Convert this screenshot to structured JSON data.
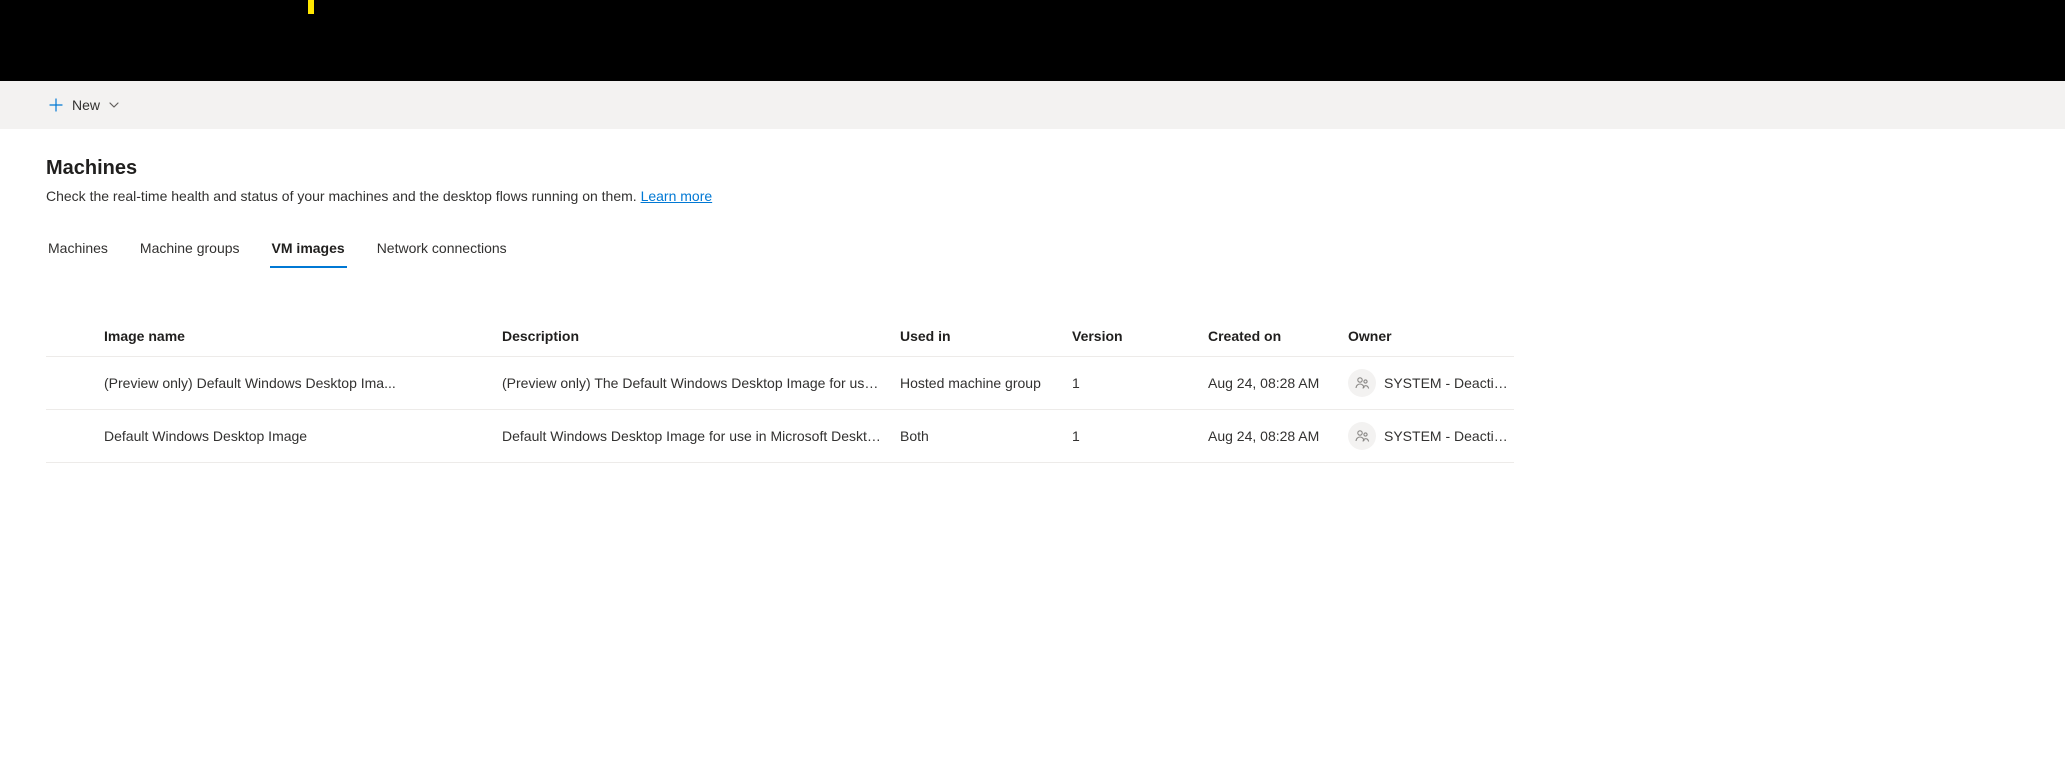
{
  "commandBar": {
    "new_label": "New"
  },
  "page": {
    "title": "Machines",
    "subtitle": "Check the real-time health and status of your machines and the desktop flows running on them. ",
    "learn_more": "Learn more"
  },
  "tabs": [
    {
      "label": "Machines",
      "active": false
    },
    {
      "label": "Machine groups",
      "active": false
    },
    {
      "label": "VM images",
      "active": true
    },
    {
      "label": "Network connections",
      "active": false
    }
  ],
  "table": {
    "headers": {
      "image_name": "Image name",
      "description": "Description",
      "used_in": "Used in",
      "version": "Version",
      "created_on": "Created on",
      "owner": "Owner"
    },
    "rows": [
      {
        "image_name": "(Preview only) Default Windows Desktop Ima...",
        "description": "(Preview only) The Default Windows Desktop Image for use i...",
        "used_in": "Hosted machine group",
        "version": "1",
        "created_on": "Aug 24, 08:28 AM",
        "owner": "SYSTEM - Deactivated..."
      },
      {
        "image_name": "Default Windows Desktop Image",
        "description": "Default Windows Desktop Image for use in Microsoft Deskto...",
        "used_in": "Both",
        "version": "1",
        "created_on": "Aug 24, 08:28 AM",
        "owner": "SYSTEM - Deactivated..."
      }
    ]
  }
}
